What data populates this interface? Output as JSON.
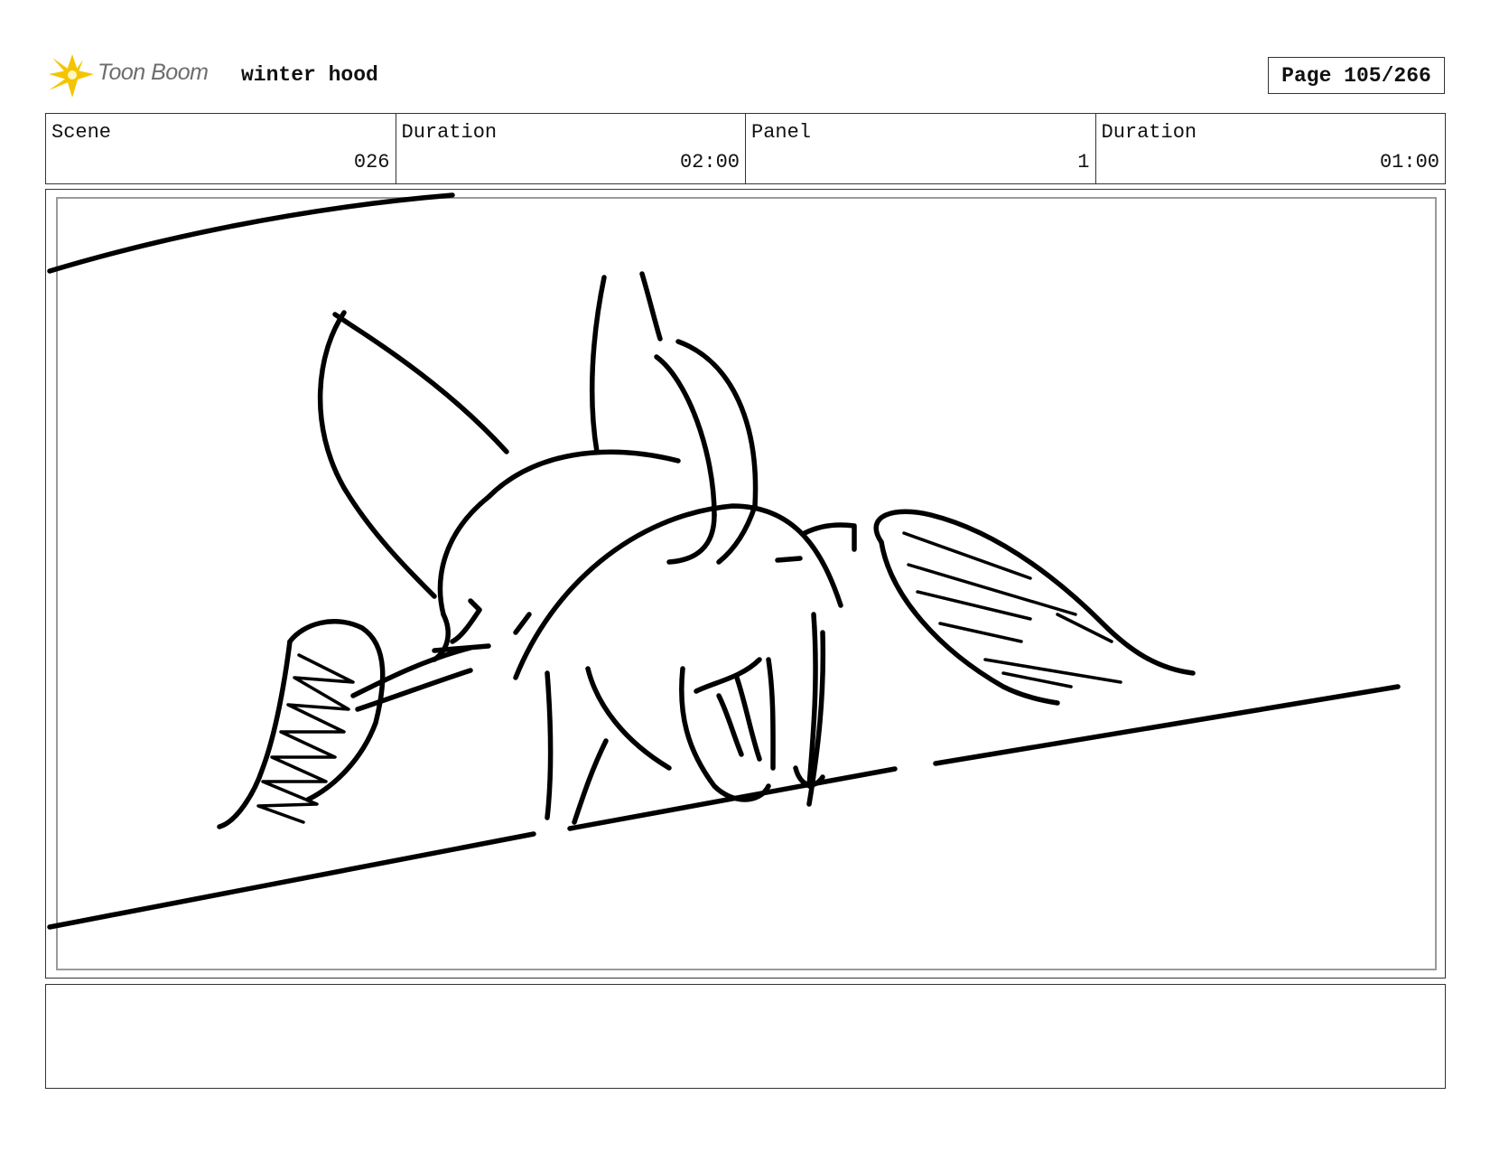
{
  "header": {
    "brand": "Toon Boom",
    "project_title": "winter hood",
    "page_indicator": "Page 105/266"
  },
  "info": [
    {
      "label": "Scene",
      "value": "026"
    },
    {
      "label": "Duration",
      "value": "02:00"
    },
    {
      "label": "Panel",
      "value": "1"
    },
    {
      "label": "Duration",
      "value": "01:00"
    }
  ],
  "notes": {
    "text": ""
  },
  "colors": {
    "logo_accent": "#f5c400",
    "logo_text": "#6d6d6d",
    "sketch_ink": "#000000",
    "frame_border": "#9a9a9a"
  },
  "icons": {
    "logo": "toon-boom-star-icon"
  }
}
